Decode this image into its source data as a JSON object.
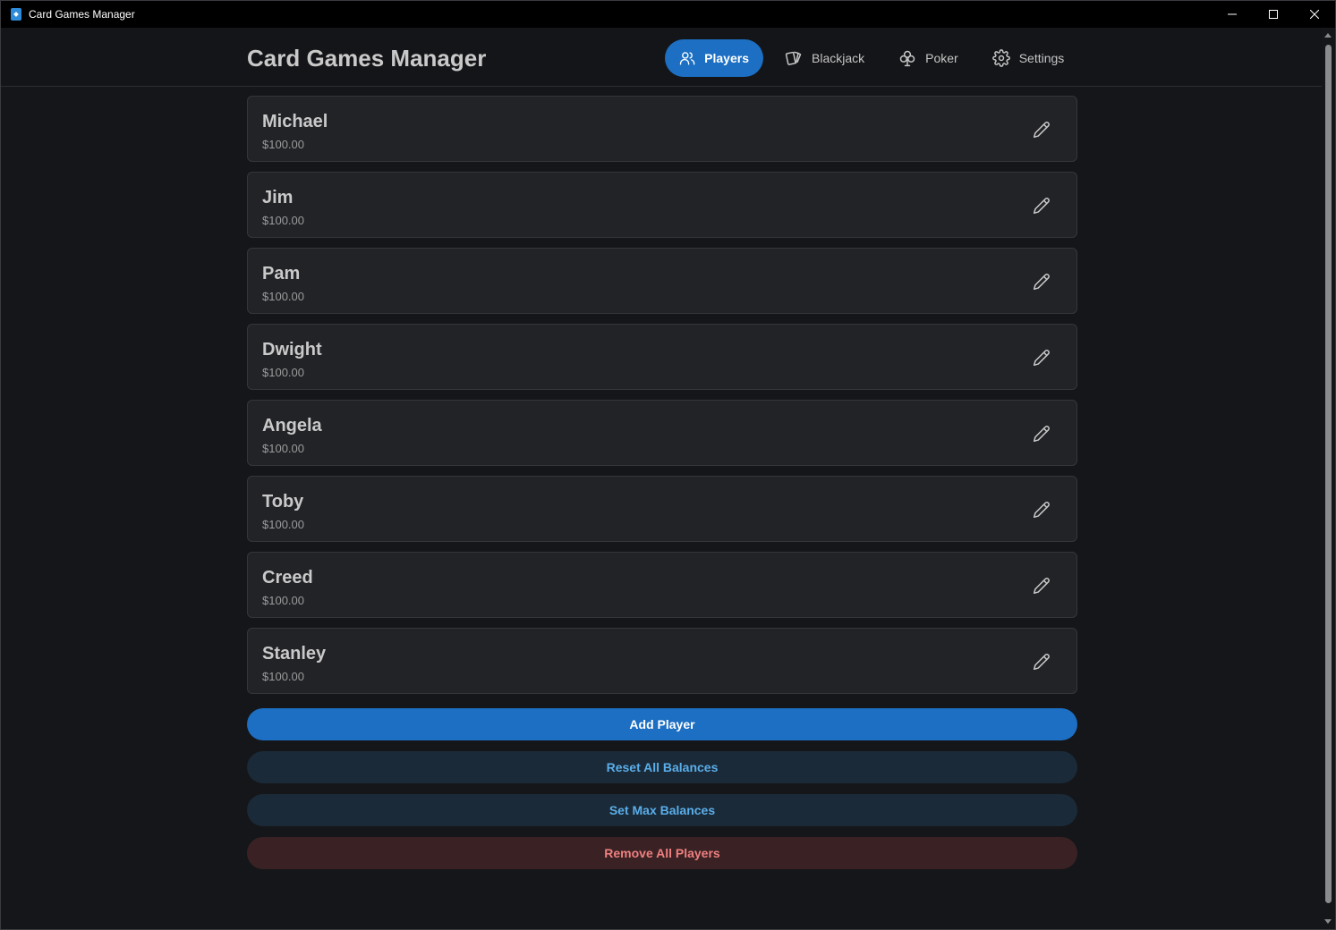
{
  "window": {
    "title": "Card Games Manager",
    "controls": [
      "minimize-icon",
      "maximize-icon",
      "close-icon"
    ]
  },
  "header": {
    "app_title": "Card Games Manager",
    "nav": [
      {
        "label": "Players",
        "icon": "users-icon",
        "active": true
      },
      {
        "label": "Blackjack",
        "icon": "cards-icon",
        "active": false
      },
      {
        "label": "Poker",
        "icon": "club-icon",
        "active": false
      },
      {
        "label": "Settings",
        "icon": "gear-icon",
        "active": false
      }
    ]
  },
  "players": [
    {
      "name": "Michael",
      "balance": "$100.00"
    },
    {
      "name": "Jim",
      "balance": "$100.00"
    },
    {
      "name": "Pam",
      "balance": "$100.00"
    },
    {
      "name": "Dwight",
      "balance": "$100.00"
    },
    {
      "name": "Angela",
      "balance": "$100.00"
    },
    {
      "name": "Toby",
      "balance": "$100.00"
    },
    {
      "name": "Creed",
      "balance": "$100.00"
    },
    {
      "name": "Stanley",
      "balance": "$100.00"
    }
  ],
  "actions": {
    "add_player": "Add Player",
    "reset_balances": "Reset All Balances",
    "set_max_balances": "Set Max Balances",
    "remove_all": "Remove All Players"
  },
  "colors": {
    "accent": "#1c6fc3",
    "secondary_text": "#5aaeea",
    "danger_text": "#ee7f7f",
    "background": "#151619",
    "card": "#222327"
  }
}
